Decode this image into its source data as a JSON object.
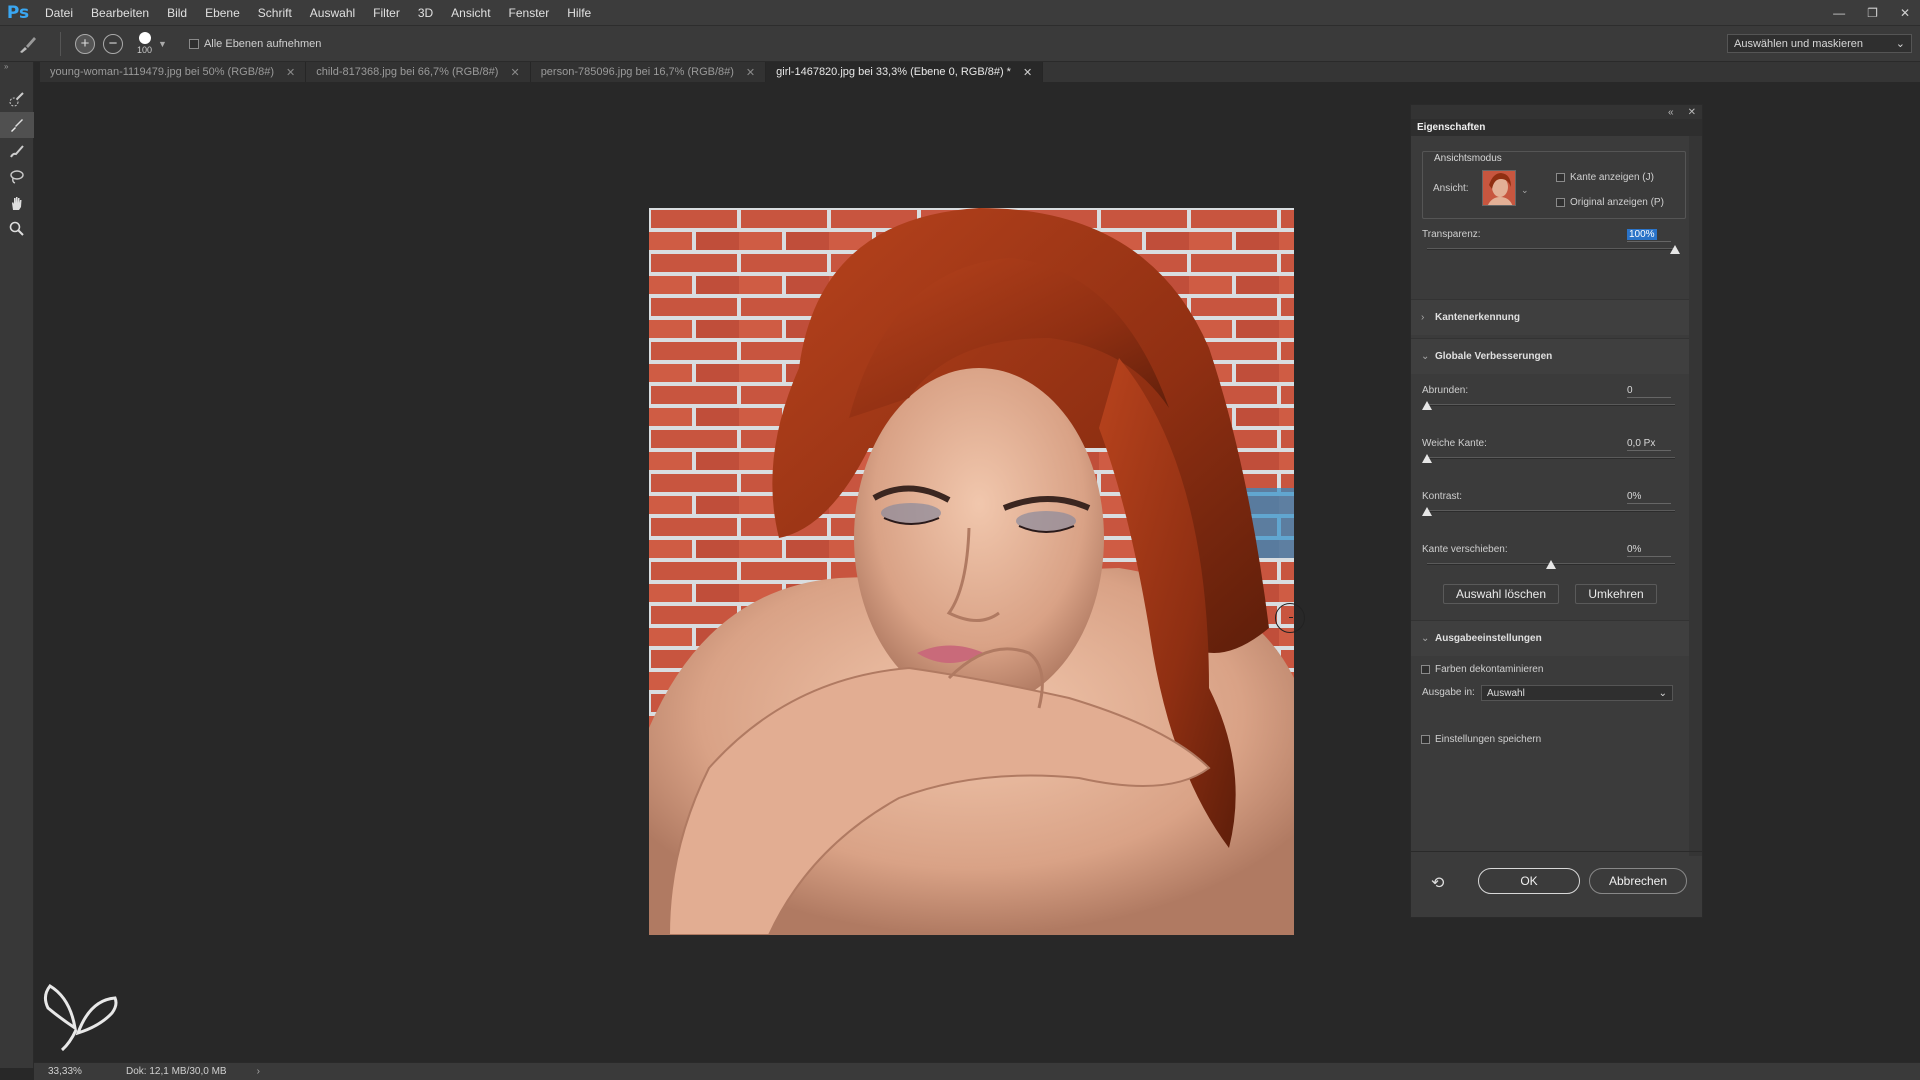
{
  "app": {
    "logo": "Ps"
  },
  "menu": [
    "Datei",
    "Bearbeiten",
    "Bild",
    "Ebene",
    "Schrift",
    "Auswahl",
    "Filter",
    "3D",
    "Ansicht",
    "Fenster",
    "Hilfe"
  ],
  "options": {
    "brush_size": "100",
    "sample_all_layers_label": "Alle Ebenen aufnehmen",
    "workspace_button": "Auswählen und maskieren"
  },
  "tabs": [
    {
      "label": "young-woman-1119479.jpg bei 50% (RGB/8#)",
      "active": false
    },
    {
      "label": "child-817368.jpg bei 66,7% (RGB/8#)",
      "active": false
    },
    {
      "label": "person-785096.jpg bei 16,7% (RGB/8#)",
      "active": false
    },
    {
      "label": "girl-1467820.jpg bei 33,3% (Ebene 0, RGB/8#) *",
      "active": true
    }
  ],
  "status": {
    "zoom": "33,33%",
    "doc": "Dok: 12,1 MB/30,0 MB"
  },
  "panel": {
    "title": "Eigenschaften",
    "view_mode_label": "Ansichtsmodus",
    "view_label": "Ansicht:",
    "show_edge_label": "Kante anzeigen (J)",
    "show_original_label": "Original anzeigen (P)",
    "transparency_label": "Transparenz:",
    "transparency_value": "100%",
    "transparency_level": 1.0,
    "edge_detection_label": "Kantenerkennung",
    "global_refinements_label": "Globale Verbesserungen",
    "smooth_label": "Abrunden:",
    "smooth_value": "0",
    "smooth_level": 0.0,
    "feather_label": "Weiche Kante:",
    "feather_value": "0,0 Px",
    "feather_level": 0.0,
    "contrast_label": "Kontrast:",
    "contrast_value": "0%",
    "contrast_level": 0.0,
    "shift_edge_label": "Kante verschieben:",
    "shift_edge_value": "0%",
    "shift_edge_level": 0.5,
    "clear_selection_label": "Auswahl löschen",
    "invert_label": "Umkehren",
    "output_settings_label": "Ausgabeeinstellungen",
    "decontaminate_label": "Farben dekontaminieren",
    "output_to_label": "Ausgabe in:",
    "output_to_value": "Auswahl",
    "remember_settings_label": "Einstellungen speichern",
    "ok_label": "OK",
    "cancel_label": "Abbrechen"
  },
  "colors": {
    "accent": "#2a73c8",
    "ps_blue": "#3aa7f2"
  }
}
